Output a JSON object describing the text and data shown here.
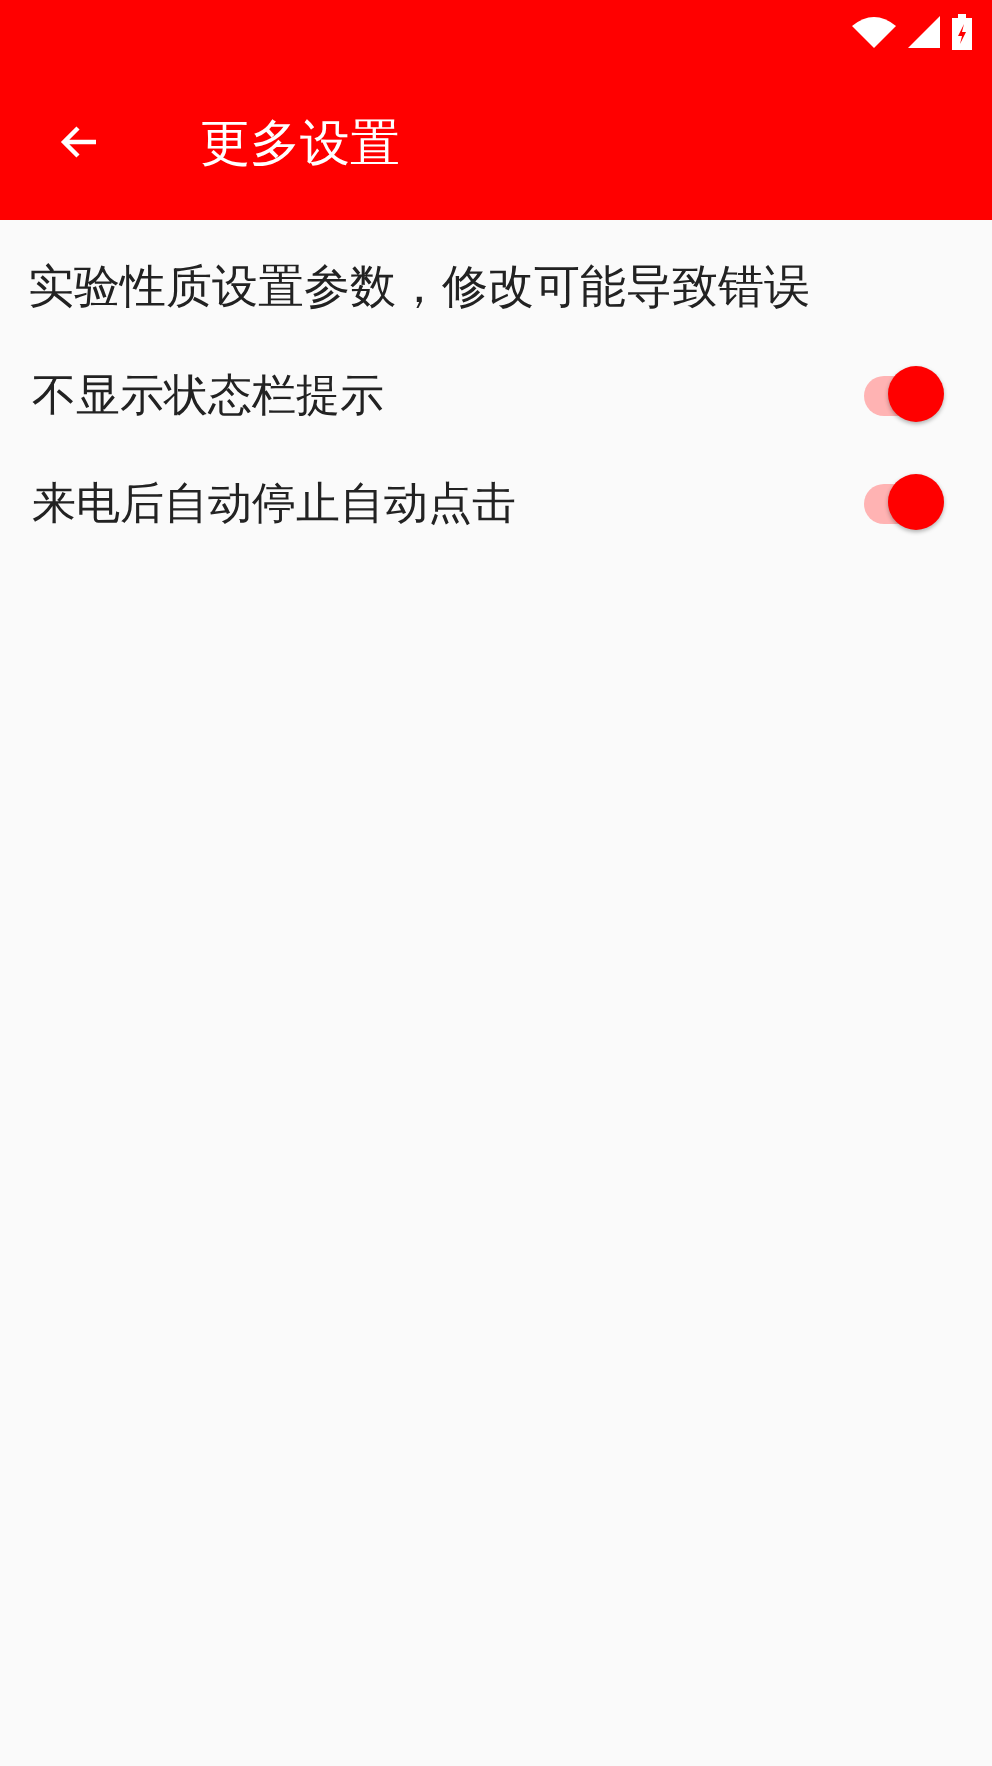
{
  "app_bar": {
    "title": "更多设置"
  },
  "notice": "实验性质设置参数，修改可能导致错误",
  "settings": [
    {
      "label": "不显示状态栏提示",
      "on": true
    },
    {
      "label": "来电后自动停止自动点击",
      "on": true
    }
  ]
}
